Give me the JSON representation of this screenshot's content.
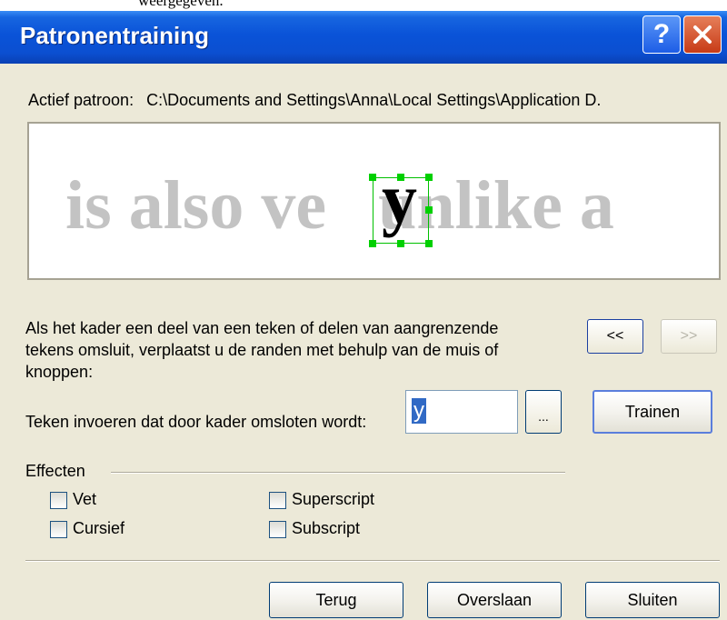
{
  "caption_fragment": "weergegeven.",
  "window": {
    "title": "Patronentraining",
    "help_label": "?",
    "close_label": "✕"
  },
  "active_pattern": {
    "label": "Actief patroon:",
    "path": "C:\\Documents and Settings\\Anna\\Local Settings\\Application D."
  },
  "preview": {
    "text": "is also ve",
    "text_after": " unlike a",
    "selected_char": "y"
  },
  "instructions": "Als het kader een deel van een teken of delen van aangrenzende tekens omsluit, verplaatst u de randen met behulp van de muis of knoppen:",
  "nav": {
    "prev_label": "<<",
    "next_label": ">>"
  },
  "char_entry": {
    "label": "Teken invoeren dat door kader omsloten wordt:",
    "value": "y",
    "browse_label": "...",
    "train_label": "Trainen"
  },
  "effects": {
    "label": "Effecten",
    "bold": "Vet",
    "italic": "Cursief",
    "superscript": "Superscript",
    "subscript": "Subscript"
  },
  "footer": {
    "back_label": "Terug",
    "skip_label": "Overslaan",
    "close_label": "Sluiten"
  },
  "colors": {
    "titlebar": "#0a53d8",
    "dialog_bg": "#ece9d8",
    "selection": "#316ac5",
    "frame_handles": "#00d000",
    "preview_text": "#c3c3c3"
  }
}
